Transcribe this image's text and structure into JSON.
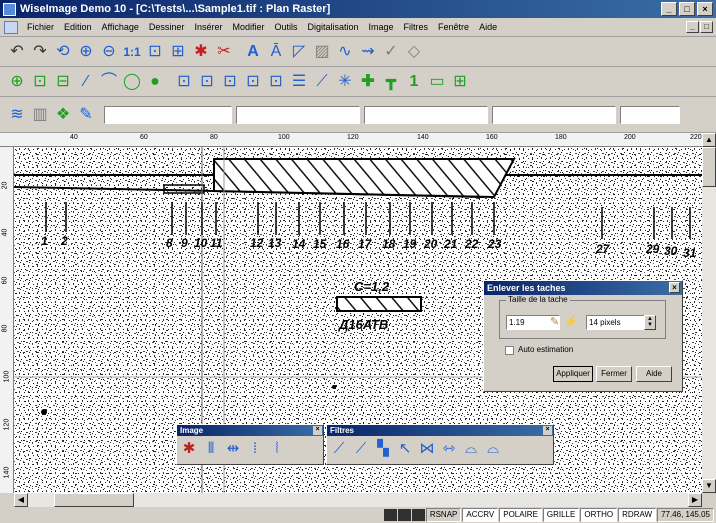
{
  "window": {
    "title": "WiseImage Demo 10 - [C:\\Tests\\...\\Sample1.tif : Plan Raster]",
    "minimize": "_",
    "maximize": "□",
    "close": "×"
  },
  "menu": {
    "items": [
      "Fichier",
      "Edition",
      "Affichage",
      "Dessiner",
      "Insérer",
      "Modifier",
      "Outils",
      "Digitalisation",
      "Image",
      "Filtres",
      "Fenêtre",
      "Aide"
    ]
  },
  "toolbar1": {
    "icons": [
      "undo-icon",
      "redo-icon",
      "rotate-icon",
      "zoom-in-icon",
      "zoom-out-icon",
      "zoom-1to1-icon",
      "zoom-window-icon",
      "zoom-select-icon",
      "tool-icon",
      "cut-icon",
      "text-a-icon",
      "text-area-icon",
      "shape-icon",
      "hatch-icon",
      "polyline-icon",
      "arrow-icon",
      "check-icon",
      "shield-icon"
    ]
  },
  "toolbar2": {
    "icons": [
      "crosshair-icon",
      "select-icon",
      "select-move-icon",
      "line-icon",
      "arc-icon",
      "circle-icon",
      "fill-icon",
      "raster-select-icon",
      "raster-select2-icon",
      "raster-select3-icon",
      "raster-select4-icon",
      "raster-select5-icon",
      "stack-icon",
      "trace-icon",
      "explode-icon",
      "cross-icon",
      "tee-icon",
      "one-icon",
      "doc-select-icon",
      "doc-plus-icon"
    ]
  },
  "toolbar3": {
    "icons": [
      "layers-icon",
      "palette-icon",
      "color-icon",
      "edit-icon"
    ]
  },
  "ruler": {
    "h_ticks": [
      "40",
      "60",
      "80",
      "100",
      "120",
      "140",
      "160",
      "180",
      "200",
      "220"
    ],
    "v_ticks": [
      "20",
      "40",
      "60",
      "80",
      "100",
      "120",
      "140"
    ]
  },
  "drawing": {
    "numbers": [
      "1",
      "2",
      "8",
      "9",
      "10",
      "11",
      "12",
      "13",
      "14",
      "15",
      "16",
      "17",
      "18",
      "19",
      "20",
      "21",
      "22",
      "23",
      "27",
      "29",
      "30",
      "31"
    ],
    "note1": "C=1,2",
    "note2": "Д16АТВ"
  },
  "dialog": {
    "title": "Enlever les taches",
    "group_label": "Taille de la tache",
    "size_value": "1.19",
    "pixels_value": "14 pixels",
    "auto_label": "Auto estimation",
    "apply": "Appliquer",
    "close": "Fermer",
    "help": "Aide"
  },
  "palette_image": {
    "title": "Image",
    "icons": [
      "despeckle-icon",
      "deskew-icon",
      "mirror-icon",
      "crop-icon",
      "align-icon"
    ]
  },
  "palette_filtres": {
    "title": "Filtres",
    "icons": [
      "filter1-icon",
      "filter2-icon",
      "filter3-icon",
      "filter4-icon",
      "filter5-icon",
      "filter6-icon",
      "filter7-icon",
      "filter8-icon"
    ]
  },
  "status": {
    "rsnap": "RSNAP",
    "accrv": "ACCRV",
    "polaire": "POLAIRE",
    "grille": "GRILLE",
    "ortho": "ORTHO",
    "rdraw": "RDRAW",
    "coords": "77.46, 145.05"
  }
}
